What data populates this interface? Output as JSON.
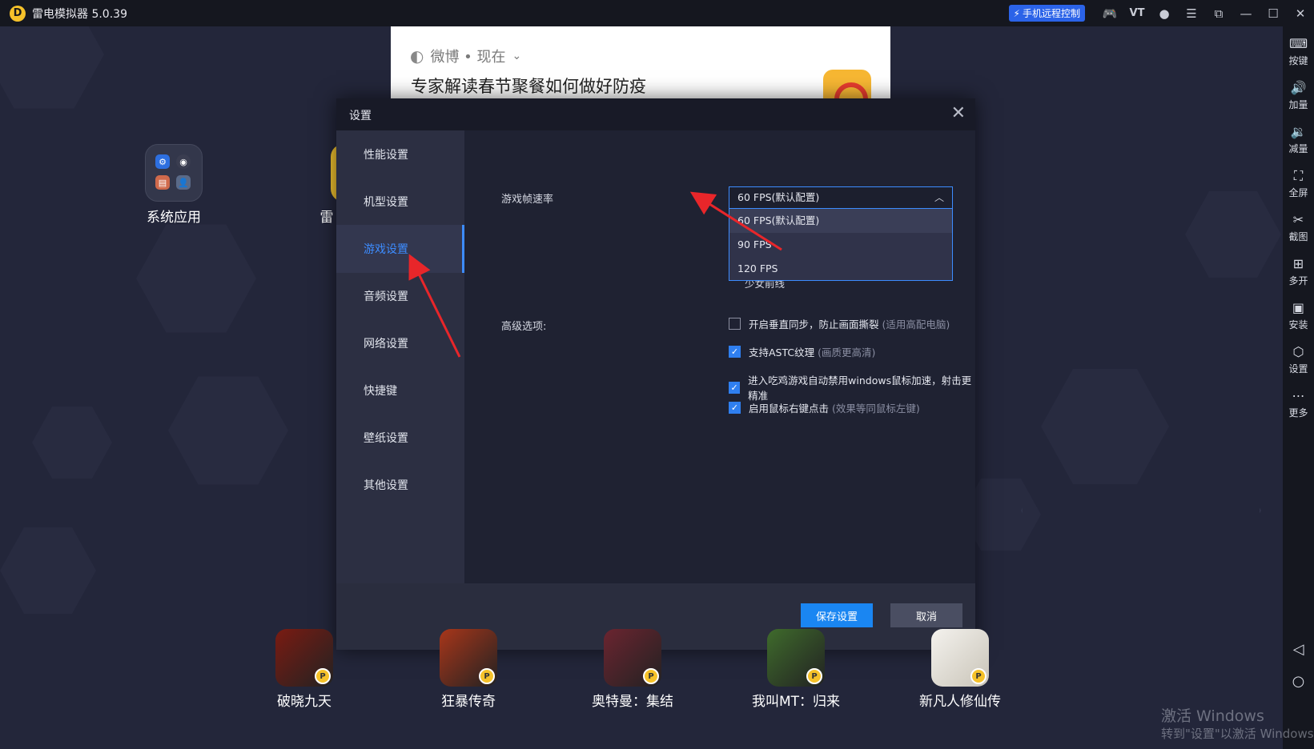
{
  "titlebar": {
    "logo": "D",
    "title": "雷电模拟器 5.0.39",
    "remote_control": "手机远程控制",
    "icons": [
      "gamepad-icon",
      "vt-icon",
      "user-icon",
      "menu-icon",
      "restore-icon",
      "minimize-icon",
      "maximize-icon",
      "close-icon"
    ],
    "vt_label": "VT"
  },
  "notification": {
    "source": "微博 • 现在",
    "title": "专家解读春节聚餐如何做好防疫"
  },
  "desktop": {
    "folder_label": "系统应用",
    "partial_app_label": "雷"
  },
  "dialog": {
    "title": "设置",
    "nav": [
      {
        "label": "性能设置"
      },
      {
        "label": "机型设置"
      },
      {
        "label": "游戏设置"
      },
      {
        "label": "音频设置"
      },
      {
        "label": "网络设置"
      },
      {
        "label": "快捷键"
      },
      {
        "label": "壁纸设置"
      },
      {
        "label": "其他设置"
      }
    ],
    "active_nav": "游戏设置",
    "fps_label": "游戏帧速率",
    "fps_selected": "60 FPS(默认配置)",
    "fps_options": [
      "60 FPS(默认配置)",
      "90 FPS",
      "120 FPS"
    ],
    "hidden_game": "少女前线",
    "advanced_label": "高级选项:",
    "options": [
      {
        "text": "开启垂直同步，防止画面撕裂",
        "hint": "(适用高配电脑)",
        "checked": false
      },
      {
        "text": "支持ASTC纹理",
        "hint": "(画质更高清)",
        "checked": true
      },
      {
        "text": "进入吃鸡游戏自动禁用windows鼠标加速，射击更精准",
        "hint": "",
        "checked": true
      },
      {
        "text": "启用鼠标右键点击",
        "hint": "(效果等同鼠标左键)",
        "checked": true
      }
    ],
    "save": "保存设置",
    "cancel": "取消"
  },
  "sidebar": {
    "items": [
      {
        "label": "按键",
        "icon": "keyboard-icon"
      },
      {
        "label": "加量",
        "icon": "volume-up-icon"
      },
      {
        "label": "减量",
        "icon": "volume-down-icon"
      },
      {
        "label": "全屏",
        "icon": "fullscreen-icon"
      },
      {
        "label": "截图",
        "icon": "scissors-icon"
      },
      {
        "label": "多开",
        "icon": "multi-instance-icon"
      },
      {
        "label": "安装",
        "icon": "apk-icon"
      },
      {
        "label": "设置",
        "icon": "gear-icon"
      },
      {
        "label": "更多",
        "icon": "more-icon"
      }
    ]
  },
  "apps": [
    {
      "label": "破晓九天",
      "color": "#7a1b12"
    },
    {
      "label": "狂暴传奇",
      "color": "#a8361a"
    },
    {
      "label": "奥特曼：集结",
      "color": "#6b2430"
    },
    {
      "label": "我叫MT：归来",
      "color": "#3f6b2c"
    },
    {
      "label": "新凡人修仙传",
      "color": "#e8e4dc"
    }
  ],
  "watermark": {
    "line1": "激活 Windows",
    "line2": "转到\"设置\"以激活 Windows"
  },
  "colors": {
    "accent": "#3d8cff",
    "save_button": "#1a86f2",
    "annotation_arrow": "#e8262a"
  }
}
